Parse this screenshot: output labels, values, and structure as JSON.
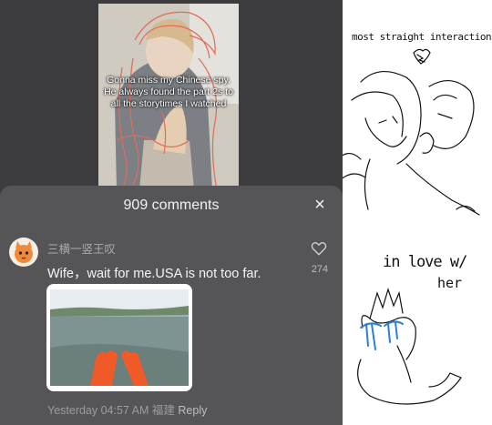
{
  "video": {
    "caption": "Gonna miss my Chinese spy. He always found the part 2s to all the storytimes I watched"
  },
  "comments": {
    "title": "909 comments",
    "close_label": "×"
  },
  "comment": {
    "author": "三横一竖王叹",
    "text": "Wife，wait for me.USA is not too far.",
    "like_count": "274",
    "timestamp": "Yesterday 04:57 AM",
    "location": "福建",
    "reply_label": "Reply"
  },
  "drawing": {
    "note_top": "most straight interaction",
    "note_love": "in love w/",
    "note_her": "her"
  },
  "colors": {
    "background_dark": "#3c3c3e",
    "sheet": "#555557",
    "sketch_red": "#e36a5a",
    "paw_orange": "#f05a28",
    "tear_blue": "#2a7fd4"
  },
  "icons": [
    "close-icon",
    "heart-icon",
    "avatar-cat-icon"
  ]
}
